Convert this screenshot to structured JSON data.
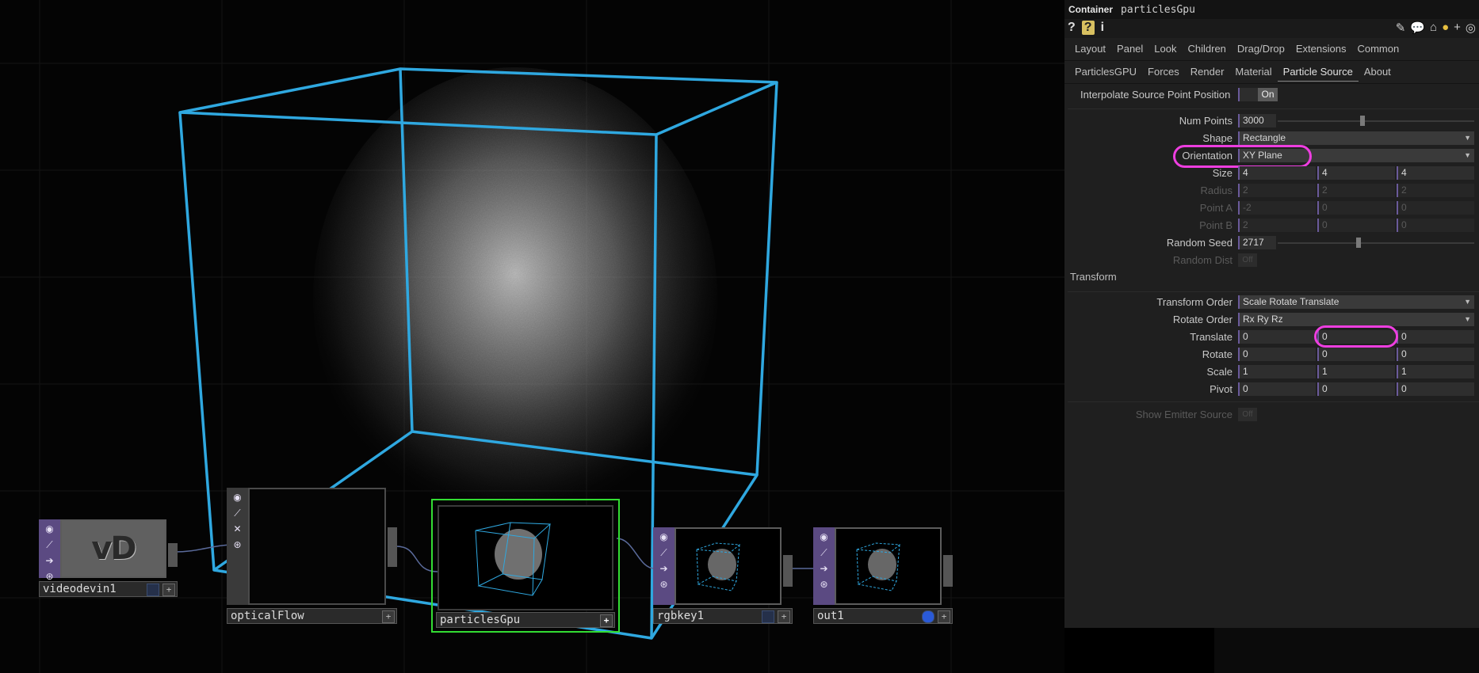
{
  "colors": {
    "wire": "#2fa8e0",
    "highlight": "#ee3ee0",
    "selected_node_border": "#33dd33",
    "accent_purple": "#5b4a82"
  },
  "network": {
    "nodes": [
      {
        "id": "videodevin1",
        "label": "videodevin1",
        "thumb_text": "vD"
      },
      {
        "id": "opticalFlow",
        "label": "opticalFlow"
      },
      {
        "id": "particlesGpu",
        "label": "particlesGpu",
        "add_button": "+"
      },
      {
        "id": "rgbkey1",
        "label": "rgbkey1"
      },
      {
        "id": "out1",
        "label": "out1"
      }
    ],
    "node_sidebar_icons": [
      "viewer-icon",
      "bypass-icon",
      "arrow-icon",
      "clone-icon"
    ]
  },
  "panel": {
    "title_kind": "Container",
    "title_name": "particlesGpu",
    "left_icons": {
      "help": "?",
      "help_op": "?",
      "info": "i"
    },
    "right_icons": [
      "pencil-icon",
      "comment-icon",
      "bookmark-icon",
      "python-icon",
      "plus-icon",
      "target-icon"
    ],
    "tabs_row1": [
      "Layout",
      "Panel",
      "Look",
      "Children",
      "Drag/Drop",
      "Extensions",
      "Common"
    ],
    "tabs_row2": [
      "ParticlesGPU",
      "Forces",
      "Render",
      "Material",
      "Particle Source",
      "About"
    ],
    "active_tab": "Particle Source",
    "params": {
      "interpolate": {
        "label": "Interpolate Source Point Position",
        "value": "On"
      },
      "num_points": {
        "label": "Num Points",
        "value": "3000",
        "slider_fraction": 0.42
      },
      "shape": {
        "label": "Shape",
        "value": "Rectangle"
      },
      "orientation": {
        "label": "Orientation",
        "value": "XY Plane"
      },
      "size": {
        "label": "Size",
        "values": [
          "4",
          "4",
          "4"
        ]
      },
      "radius": {
        "label": "Radius",
        "values": [
          "2",
          "2",
          "2"
        ]
      },
      "point_a": {
        "label": "Point A",
        "values": [
          "-2",
          "0",
          "0"
        ]
      },
      "point_b": {
        "label": "Point B",
        "values": [
          "2",
          "0",
          "0"
        ]
      },
      "random_seed": {
        "label": "Random Seed",
        "value": "2717",
        "slider_fraction": 0.4
      },
      "random_dist": {
        "label": "Random Dist",
        "value": "Off"
      },
      "transform_section": "Transform",
      "transform_order": {
        "label": "Transform Order",
        "value": "Scale Rotate Translate"
      },
      "rotate_order": {
        "label": "Rotate Order",
        "value": "Rx Ry Rz"
      },
      "translate": {
        "label": "Translate",
        "values": [
          "0",
          "0",
          "0"
        ]
      },
      "rotate": {
        "label": "Rotate",
        "values": [
          "0",
          "0",
          "0"
        ]
      },
      "scale": {
        "label": "Scale",
        "values": [
          "1",
          "1",
          "1"
        ]
      },
      "pivot": {
        "label": "Pivot",
        "values": [
          "0",
          "0",
          "0"
        ]
      },
      "show_emitter": {
        "label": "Show Emitter Source",
        "value": "Off"
      }
    }
  }
}
